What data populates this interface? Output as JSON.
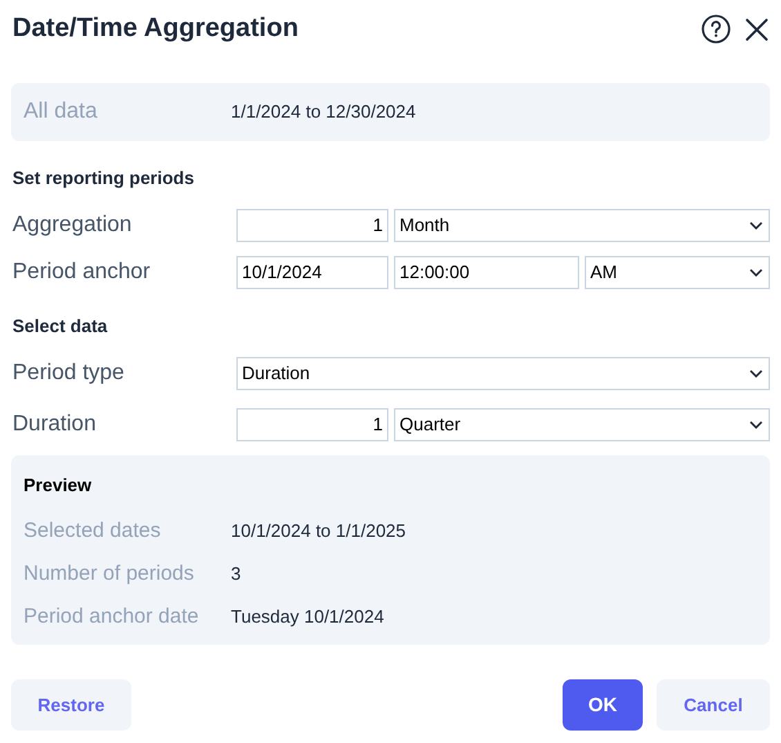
{
  "dialog": {
    "title": "Date/Time Aggregation"
  },
  "summary": {
    "label": "All data",
    "value": "1/1/2024 to 12/30/2024"
  },
  "sections": [
    {
      "heading": "Set reporting periods",
      "rows": [
        {
          "label": "Aggregation",
          "controls": [
            {
              "kind": "number",
              "value": "1"
            },
            {
              "kind": "select",
              "value": "Month"
            }
          ]
        },
        {
          "label": "Period anchor",
          "controls": [
            {
              "kind": "text",
              "value": "10/1/2024"
            },
            {
              "kind": "text",
              "value": "12:00:00"
            },
            {
              "kind": "select",
              "value": "AM"
            }
          ]
        }
      ]
    },
    {
      "heading": "Select data",
      "rows": [
        {
          "label": "Period type",
          "controls": [
            {
              "kind": "select",
              "value": "Duration"
            }
          ]
        },
        {
          "label": "Duration",
          "controls": [
            {
              "kind": "number",
              "value": "1"
            },
            {
              "kind": "select",
              "value": "Quarter"
            }
          ]
        }
      ]
    }
  ],
  "preview": {
    "heading": "Preview",
    "rows": [
      {
        "label": "Selected dates",
        "value": "10/1/2024 to 1/1/2025"
      },
      {
        "label": "Number of periods",
        "value": "3"
      },
      {
        "label": "Period anchor date",
        "value": "Tuesday 10/1/2024"
      }
    ]
  },
  "buttons": [
    {
      "label": "Restore",
      "kind": "secondary"
    },
    {
      "label": "OK",
      "kind": "primary"
    },
    {
      "label": "Cancel",
      "kind": "secondary"
    }
  ]
}
